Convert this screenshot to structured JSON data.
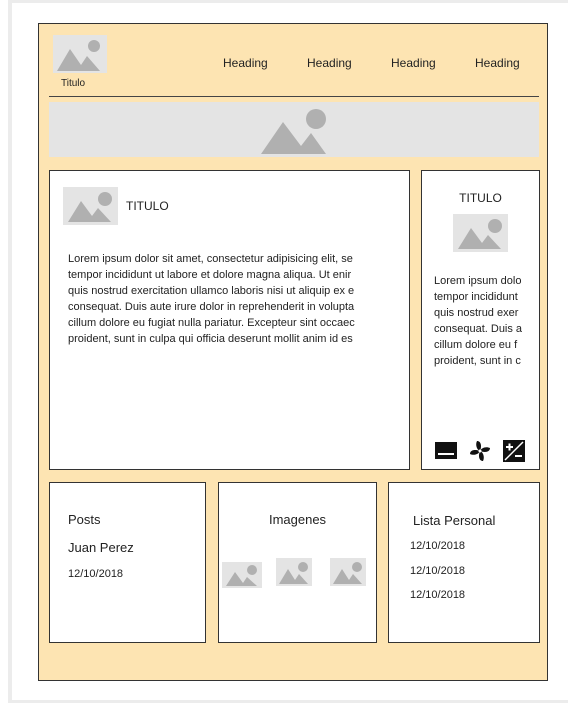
{
  "header": {
    "logo_caption": "Titulo",
    "nav": [
      "Heading",
      "Heading",
      "Heading",
      "Heading"
    ]
  },
  "main": {
    "title": "TITULO",
    "body": [
      "Lorem ipsum dolor sit amet, consectetur adipisicing elit, se",
      "tempor incididunt ut labore et dolore magna aliqua. Ut enir",
      "quis nostrud exercitation ullamco laboris nisi ut aliquip ex e",
      "consequat. Duis aute irure dolor in reprehenderit in volupta",
      "cillum dolore eu fugiat nulla pariatur. Excepteur sint occaec",
      "proident, sunt in culpa qui officia deserunt mollit anim id es"
    ]
  },
  "side": {
    "title": "TITULO",
    "body": [
      "Lorem ipsum dolo",
      "tempor incididunt",
      "quis nostrud exer",
      "consequat. Duis a",
      "cillum dolore eu f",
      "proident, sunt in c"
    ],
    "icons": [
      "subtitles-icon",
      "fan-icon",
      "exposure-icon"
    ]
  },
  "posts": {
    "title": "Posts",
    "author": "Juan Perez",
    "date": "12/10/2018"
  },
  "images": {
    "title": "Imagenes"
  },
  "list": {
    "title": "Lista Personal",
    "items": [
      "12/10/2018",
      "12/10/2018",
      "12/10/2018"
    ]
  },
  "colors": {
    "page_background": "#fde4b2",
    "placeholder": "#e4e4e4",
    "placeholder_shape": "#b0b0b0",
    "border": "#333333"
  }
}
